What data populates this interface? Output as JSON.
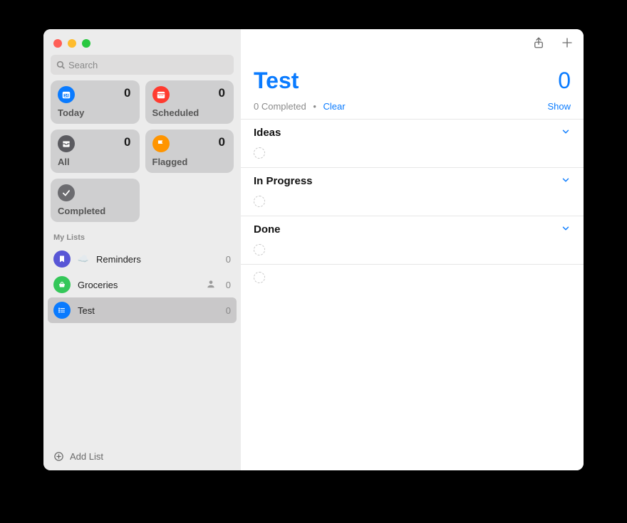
{
  "search": {
    "placeholder": "Search"
  },
  "smartCards": {
    "today": {
      "label": "Today",
      "count": "0",
      "color": "#0a7bff"
    },
    "scheduled": {
      "label": "Scheduled",
      "count": "0",
      "color": "#ff3b30"
    },
    "all": {
      "label": "All",
      "count": "0",
      "color": "#5b5b60"
    },
    "flagged": {
      "label": "Flagged",
      "count": "0",
      "color": "#ff9500"
    },
    "completed": {
      "label": "Completed",
      "color": "#6c6c70"
    }
  },
  "myListsHeader": "My Lists",
  "lists": [
    {
      "name": "Reminders",
      "count": "0",
      "color": "#5856d6",
      "icon": "bookmark",
      "cloud": true,
      "shared": false,
      "selected": false
    },
    {
      "name": "Groceries",
      "count": "0",
      "color": "#34c759",
      "icon": "basket",
      "cloud": false,
      "shared": true,
      "selected": false
    },
    {
      "name": "Test",
      "count": "0",
      "color": "#0a7bff",
      "icon": "list",
      "cloud": false,
      "shared": false,
      "selected": true
    }
  ],
  "addListLabel": "Add List",
  "main": {
    "title": "Test",
    "count": "0",
    "completedLine": "0 Completed",
    "clearLabel": "Clear",
    "showLabel": "Show",
    "sections": [
      {
        "name": "Ideas"
      },
      {
        "name": "In Progress"
      },
      {
        "name": "Done"
      }
    ]
  }
}
